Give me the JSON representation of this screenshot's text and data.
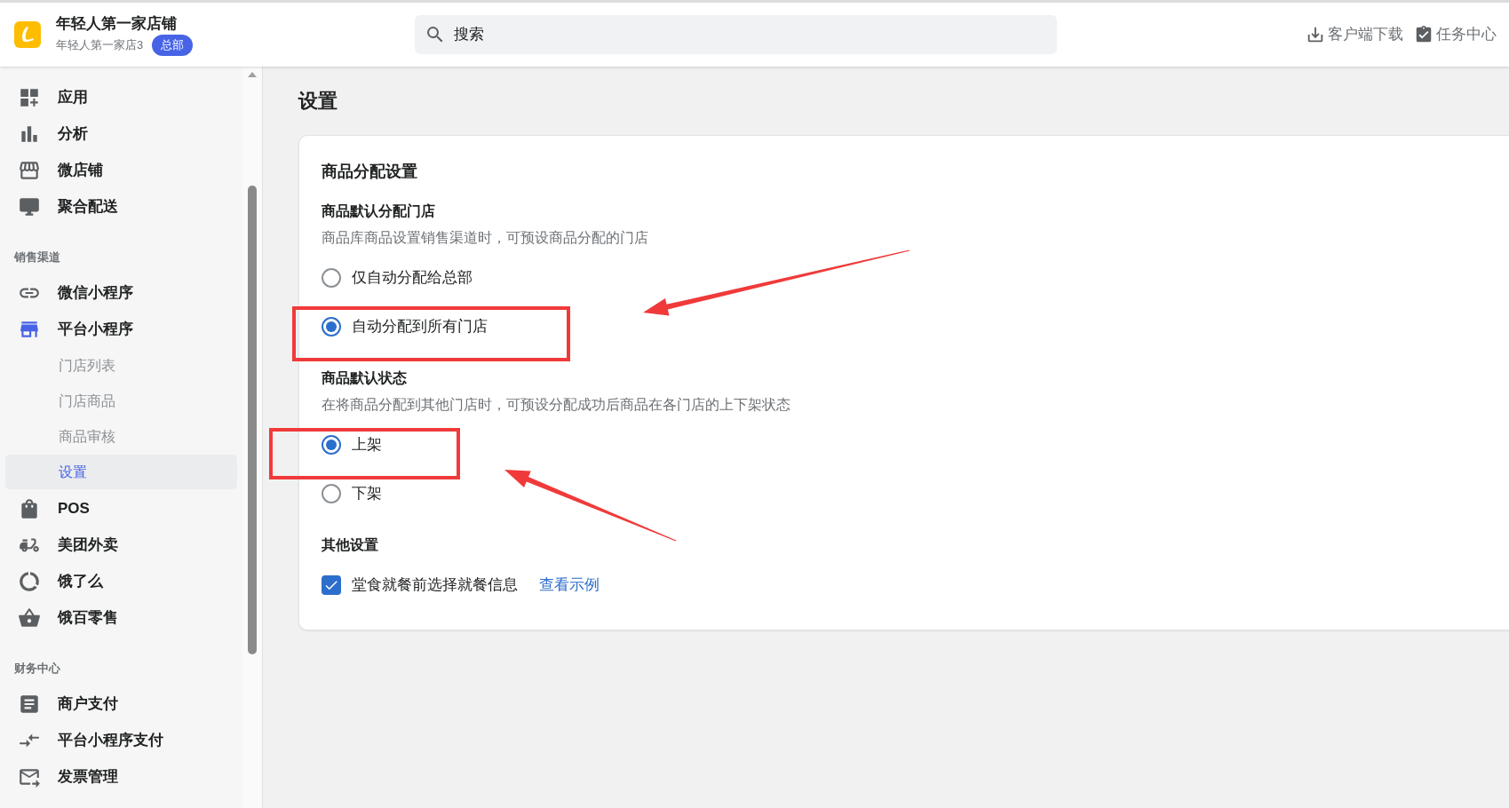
{
  "header": {
    "store_name": "年轻人第一家店铺",
    "branch_name": "年轻人第一家店3",
    "badge": "总部",
    "search": {
      "placeholder": "搜索"
    },
    "actions": [
      {
        "label": "客户端下载"
      },
      {
        "label": "任务中心"
      }
    ]
  },
  "sidebar": {
    "sections": [
      {
        "items": [
          {
            "label": "应用",
            "selected": false
          },
          {
            "label": "分析",
            "selected": false
          },
          {
            "label": "微店铺",
            "selected": false
          },
          {
            "label": "聚合配送",
            "selected": false
          }
        ]
      },
      {
        "title": "销售渠道",
        "items": [
          {
            "label": "微信小程序",
            "selected": false
          },
          {
            "label": "平台小程序",
            "selected": true,
            "expanded": true,
            "children": [
              {
                "label": "门店列表",
                "selected": false
              },
              {
                "label": "门店商品",
                "selected": false
              },
              {
                "label": "商品审核",
                "selected": false
              },
              {
                "label": "设置",
                "selected": true
              }
            ]
          },
          {
            "label": "POS",
            "selected": false
          },
          {
            "label": "美团外卖",
            "selected": false
          },
          {
            "label": "饿了么",
            "selected": false
          },
          {
            "label": "饿百零售",
            "selected": false
          }
        ]
      },
      {
        "title": "财务中心",
        "items": [
          {
            "label": "商户支付",
            "selected": false
          },
          {
            "label": "平台小程序支付",
            "selected": false
          },
          {
            "label": "发票管理",
            "selected": false
          }
        ]
      }
    ]
  },
  "page": {
    "title": "设置",
    "card": {
      "title": "商品分配设置",
      "groups": [
        {
          "kind": "radio",
          "title": "商品默认分配门店",
          "description": "商品库商品设置销售渠道时，可预设商品分配的门店",
          "options": [
            {
              "label": "仅自动分配给总部",
              "selected": false
            },
            {
              "label": "自动分配到所有门店",
              "selected": true
            }
          ]
        },
        {
          "kind": "radio",
          "title": "商品默认状态",
          "description": "在将商品分配到其他门店时，可预设分配成功后商品在各门店的上下架状态",
          "options": [
            {
              "label": "上架",
              "selected": true
            },
            {
              "label": "下架",
              "selected": false
            }
          ]
        },
        {
          "kind": "checkbox",
          "title": "其他设置",
          "options": [
            {
              "label": "堂食就餐前选择就餐信息",
              "checked": true,
              "link": "查看示例"
            }
          ]
        }
      ]
    }
  }
}
